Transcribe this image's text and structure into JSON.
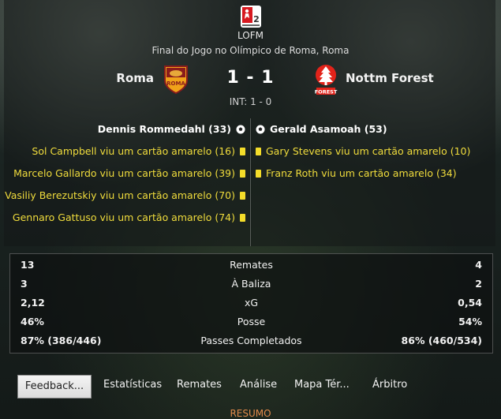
{
  "competition": {
    "logo_icon": "bundesliga-2-icon",
    "name": "LOFM",
    "subtitle": "Final do Jogo no Olímpico de Roma, Roma"
  },
  "match": {
    "home_team": "Roma",
    "away_team": "Nottm Forest",
    "home_crest_icon": "roma-crest-icon",
    "away_crest_icon": "nottm-forest-crest-icon",
    "score": "1 - 1",
    "halftime": "INT: 1 - 0"
  },
  "events": {
    "home": [
      {
        "type": "goal",
        "text": "Dennis Rommedahl (33)"
      },
      {
        "type": "yellow",
        "text": "Sol Campbell viu um cartão amarelo (16)"
      },
      {
        "type": "yellow",
        "text": "Marcelo Gallardo viu um cartão amarelo (39)"
      },
      {
        "type": "yellow",
        "text": "Vasiliy Berezutskiy viu um cartão amarelo (70)"
      },
      {
        "type": "yellow",
        "text": "Gennaro Gattuso viu um cartão amarelo (74)"
      }
    ],
    "away": [
      {
        "type": "goal",
        "text": "Gerald Asamoah (53)"
      },
      {
        "type": "yellow",
        "text": "Gary Stevens viu um cartão amarelo (10)"
      },
      {
        "type": "yellow",
        "text": "Franz Roth viu um cartão amarelo (34)"
      }
    ]
  },
  "stats": [
    {
      "label": "Remates",
      "home": "13",
      "away": "4"
    },
    {
      "label": "À Baliza",
      "home": "3",
      "away": "2"
    },
    {
      "label": "xG",
      "home": "2,12",
      "away": "0,54"
    },
    {
      "label": "Posse",
      "home": "46%",
      "away": "54%"
    },
    {
      "label": "Passes Completados",
      "home": "87% (386/446)",
      "away": "86% (460/534)"
    }
  ],
  "tabs": {
    "feedback": "Feedback...",
    "estatisticas": "Estatísticas",
    "remates": "Remates",
    "analise": "Análise",
    "mapa": "Mapa Tér...",
    "arbitro": "Árbitro"
  },
  "footer": {
    "resumo": "RESUMO"
  },
  "colors": {
    "yellow_card": "#f4dd2a",
    "event_text": "#f0dc3c",
    "resumo": "#e08a4a"
  }
}
